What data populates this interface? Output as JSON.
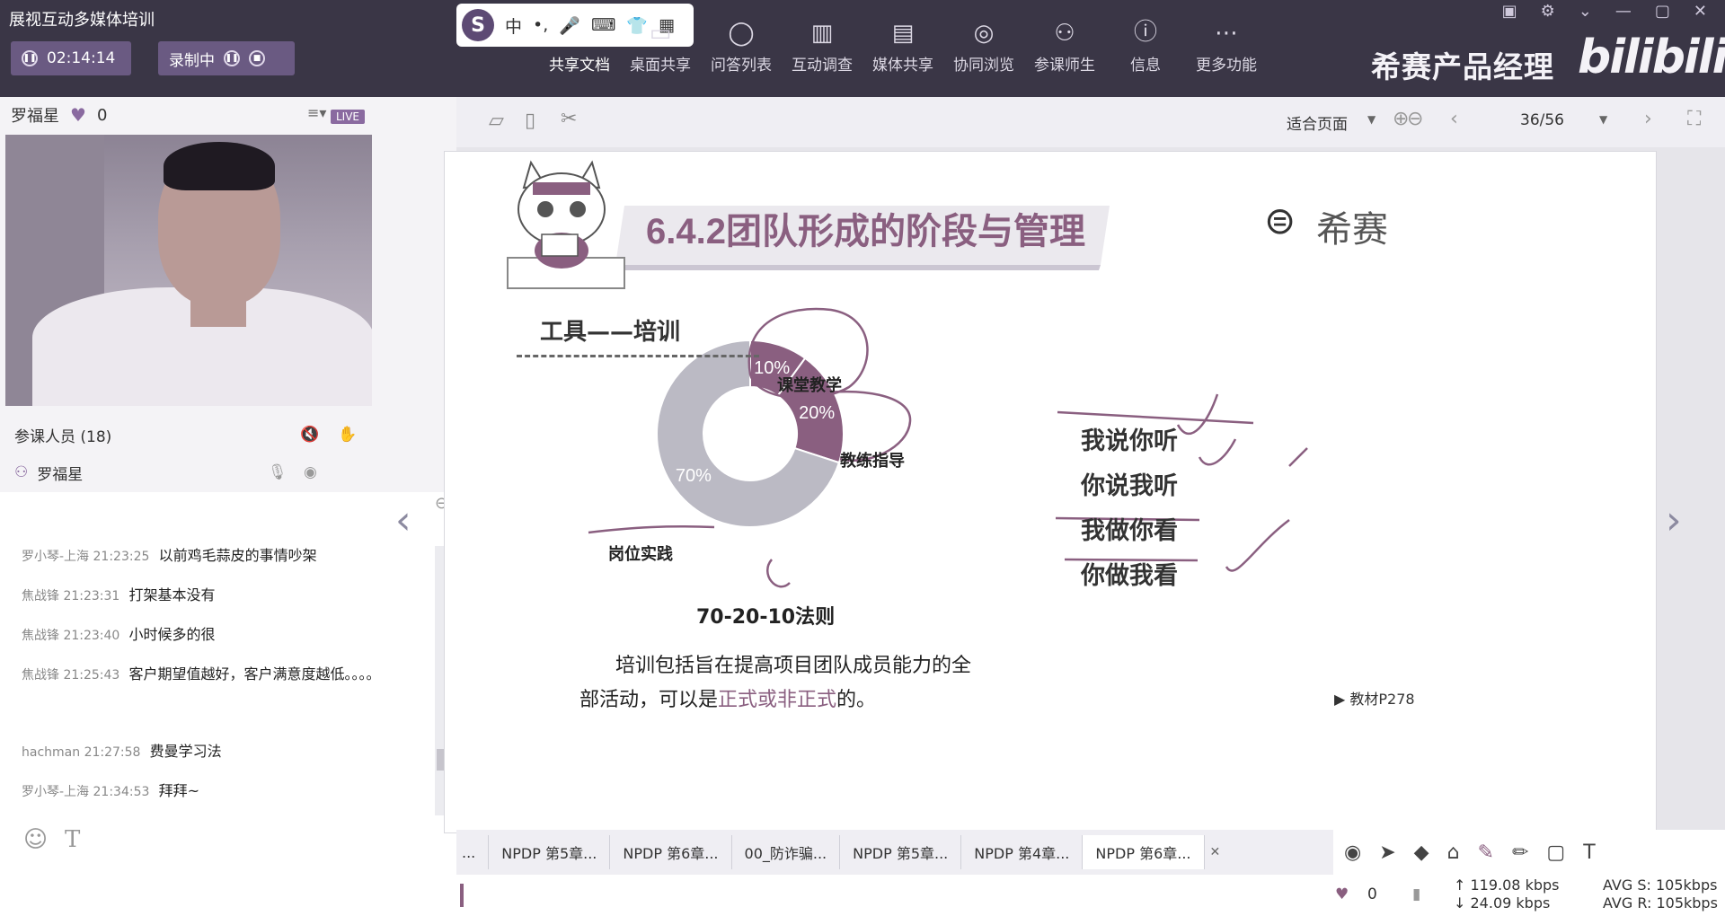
{
  "app": {
    "title": "展视互动多媒体培训"
  },
  "timer": "02:14:14",
  "record": "录制中",
  "ime": {
    "mode": "中",
    "punct": "•,"
  },
  "toolbar": [
    {
      "label": "共享文档",
      "icon": "share-doc-icon"
    },
    {
      "label": "桌面共享",
      "icon": "desktop-share-icon"
    },
    {
      "label": "问答列表",
      "icon": "qa-icon"
    },
    {
      "label": "互动调查",
      "icon": "survey-icon"
    },
    {
      "label": "媒体共享",
      "icon": "media-icon"
    },
    {
      "label": "协同浏览",
      "icon": "browse-icon"
    },
    {
      "label": "参课师生",
      "icon": "participants-icon"
    },
    {
      "label": "信息",
      "icon": "info-icon"
    },
    {
      "label": "更多功能",
      "icon": "more-icon"
    }
  ],
  "brand": "希赛产品经理",
  "bili": "bilibili",
  "presenter": {
    "name": "罗福星",
    "likes": "0",
    "live": "LIVE"
  },
  "participants": {
    "label": "参课人员 (18)",
    "me": "罗福星"
  },
  "chat": [
    {
      "who": "罗小琴-上海 21:23:25",
      "text": "以前鸡毛蒜皮的事情吵架"
    },
    {
      "who": "焦战锋 21:23:31",
      "text": "打架基本没有"
    },
    {
      "who": "焦战锋 21:23:40",
      "text": "小时候多的很"
    },
    {
      "who": "焦战锋 21:25:43",
      "text": "客户期望值越好，客户满意度越低。。。。"
    },
    {
      "who": "hachman 21:27:58",
      "text": "费曼学习法"
    },
    {
      "who": "罗小琴-上海 21:34:53",
      "text": "拜拜~"
    }
  ],
  "viewer": {
    "fit": "适合页面",
    "page": "36/56"
  },
  "slide": {
    "title": "6.4.2团队形成的阶段与管理",
    "logo": "希赛",
    "section": "工具——培训",
    "rule": "70-20-10法则",
    "body1": "培训包括旨在提高项目团队成员能力的全",
    "body2a": "部活动，可以是",
    "body2b": "正式或非正式",
    "body2c": "的。",
    "ref": "教材P278",
    "bullets": [
      "我说你听",
      "你说我听",
      "我做你看",
      "你做我看"
    ]
  },
  "chart_data": {
    "type": "pie",
    "categories": [
      "课堂教学",
      "教练指导",
      "岗位实践"
    ],
    "values": [
      10,
      20,
      70
    ],
    "labels": [
      "10%",
      "20%",
      "70%"
    ]
  },
  "tabs": [
    "NPDP 第5章...",
    "NPDP 第6章...",
    "00_防诈骗...",
    "NPDP 第5章...",
    "NPDP 第4章...",
    "NPDP 第6章..."
  ],
  "status": {
    "likes": "0",
    "up": "119.08 kbps",
    "down": "24.09 kbps",
    "avg_s": "AVG S: 105kbps",
    "avg_r": "AVG R: 105kbps"
  },
  "colors": {
    "accent": "#8a5f80",
    "chrome": "#3a3646",
    "slice_gray": "#bbbac4"
  }
}
